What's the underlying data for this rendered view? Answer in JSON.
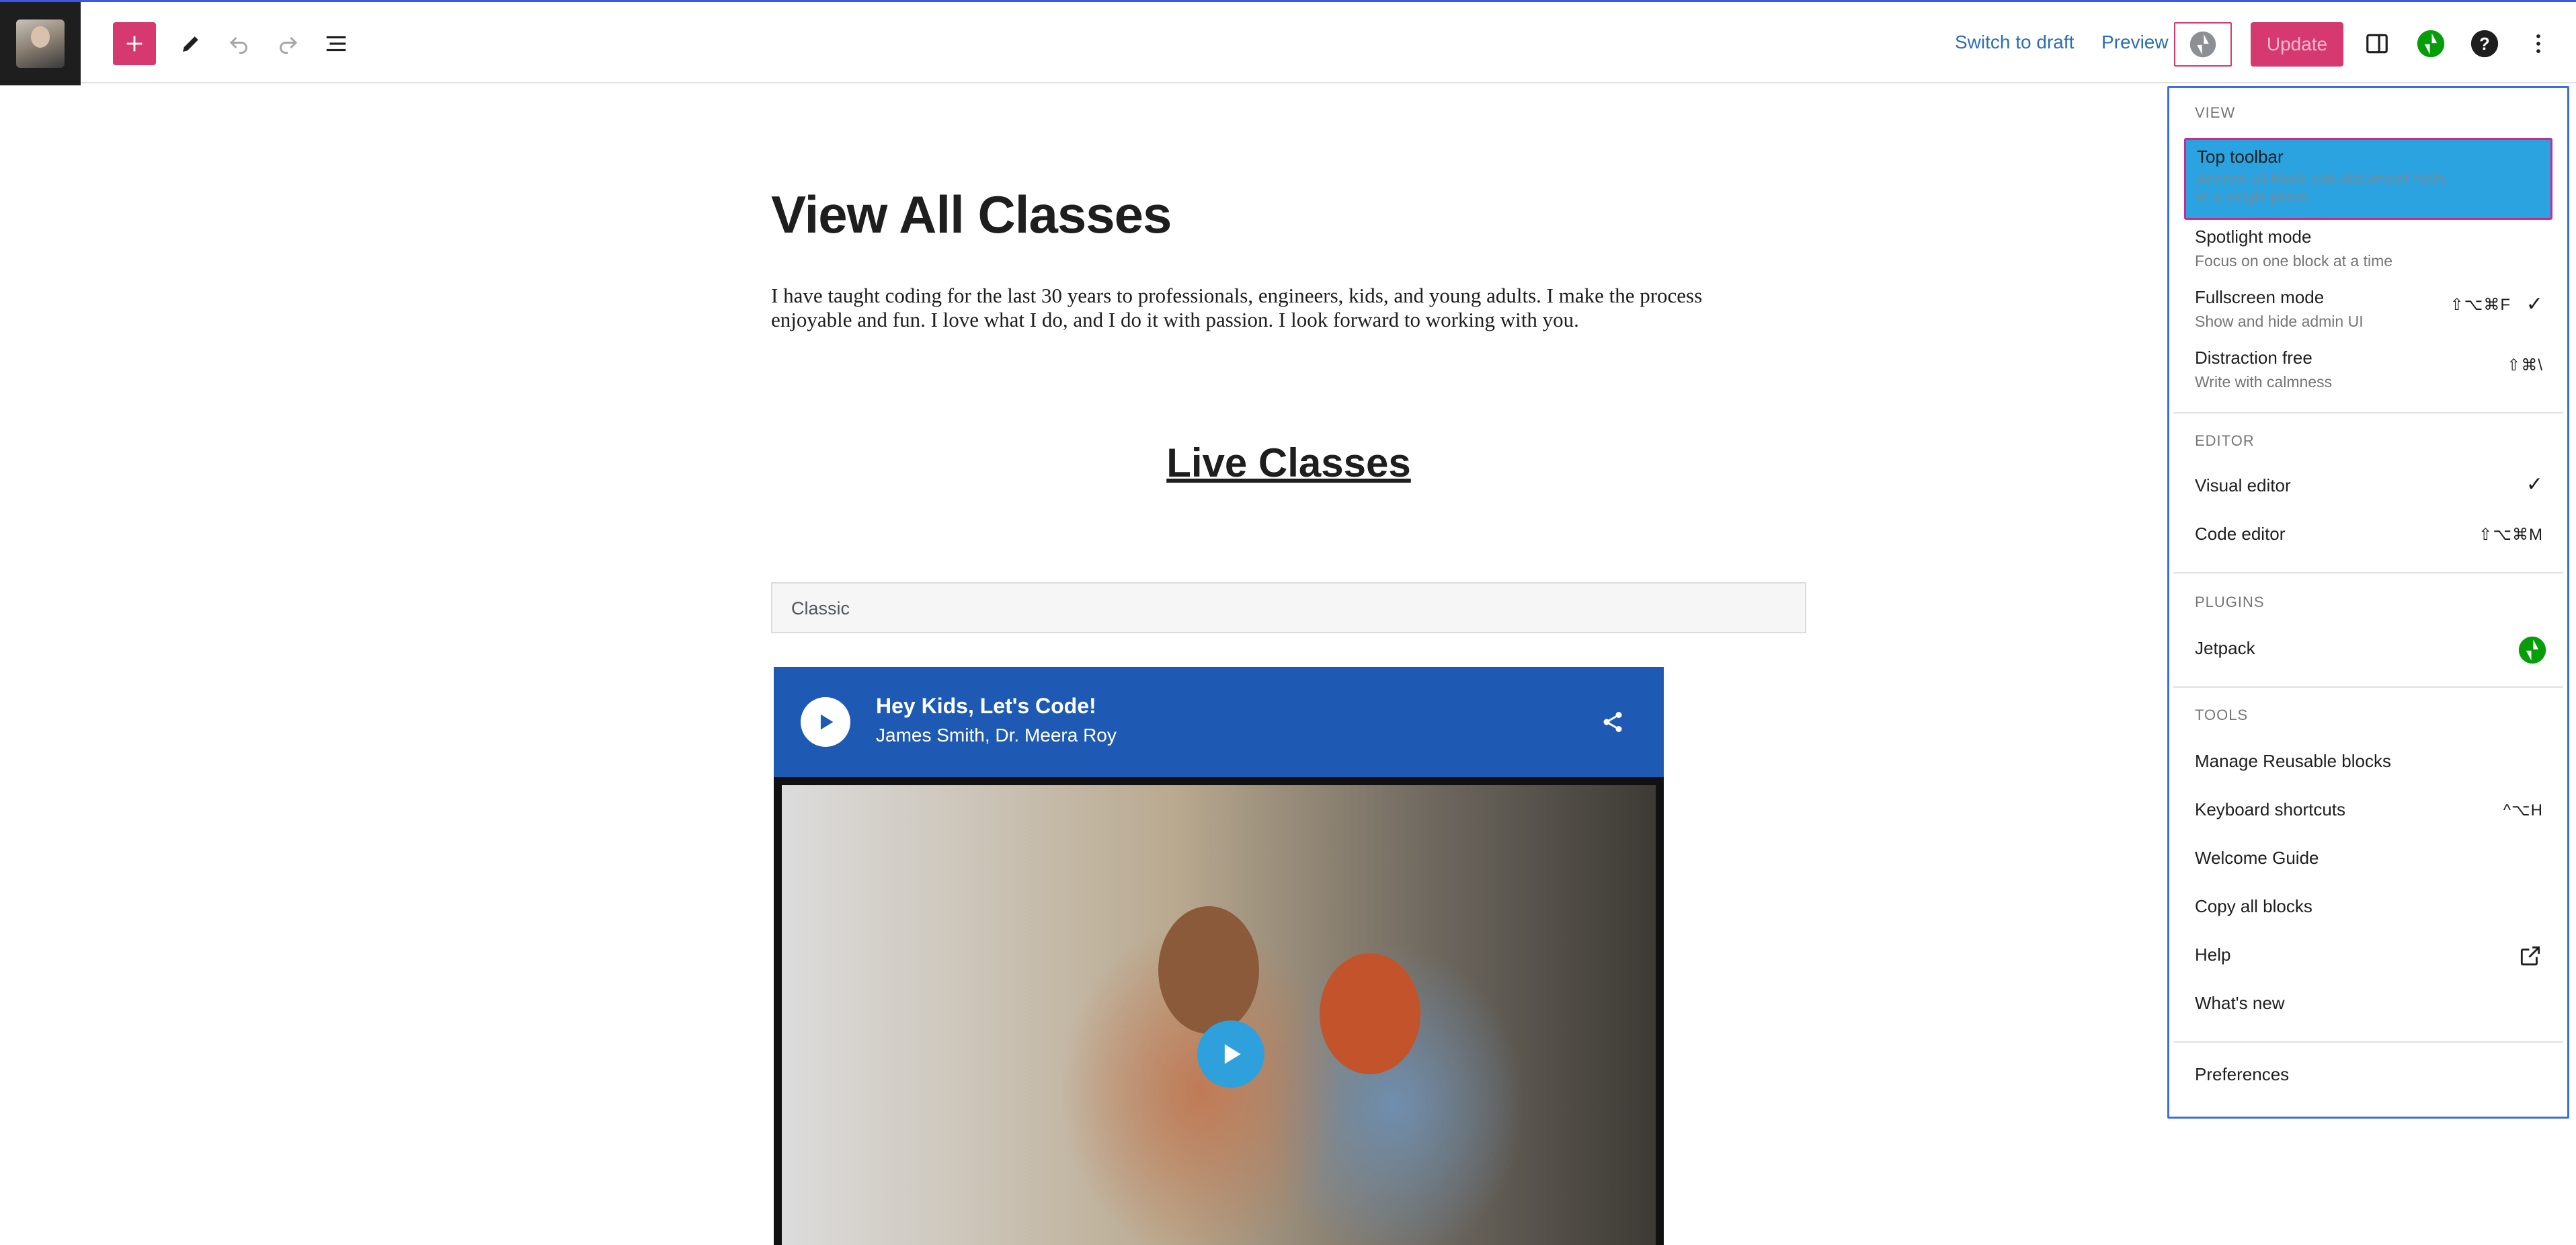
{
  "toolbar": {
    "switch_to_draft": "Switch to draft",
    "preview": "Preview",
    "update": "Update"
  },
  "content": {
    "title": "View All Classes",
    "intro": "I have taught coding for the last 30 years to professionals, engineers, kids, and young adults. I make the process enjoyable and fun. I love what I do, and I do it with passion. I look forward to working with you.",
    "section_heading": "Live Classes",
    "classic_label": "Classic",
    "player": {
      "title": "Hey Kids, Let's Code!",
      "subtitle": "James Smith, Dr. Meera Roy"
    }
  },
  "menu": {
    "view": {
      "label": "VIEW",
      "items": [
        {
          "label": "Top toolbar",
          "desc1": "Access all block and document tools",
          "desc2": "in a single place",
          "selected": true
        },
        {
          "label": "Spotlight mode",
          "desc1": "Focus on one block at a time"
        },
        {
          "label": "Fullscreen mode",
          "desc1": "Show and hide admin UI",
          "shortcut": "⇧⌥⌘F",
          "checked": true
        },
        {
          "label": "Distraction free",
          "desc1": "Write with calmness",
          "shortcut": "⇧⌘\\"
        }
      ]
    },
    "editor": {
      "label": "EDITOR",
      "items": [
        {
          "label": "Visual editor",
          "checked": true
        },
        {
          "label": "Code editor",
          "shortcut": "⇧⌥⌘M"
        }
      ]
    },
    "plugins": {
      "label": "PLUGINS",
      "items": [
        {
          "label": "Jetpack",
          "icon": "jetpack-icon"
        }
      ]
    },
    "tools": {
      "label": "TOOLS",
      "items": [
        {
          "label": "Manage Reusable blocks"
        },
        {
          "label": "Keyboard shortcuts",
          "shortcut": "^⌥H"
        },
        {
          "label": "Welcome Guide"
        },
        {
          "label": "Copy all blocks"
        },
        {
          "label": "Help",
          "icon": "external-link-icon"
        },
        {
          "label": "What's new"
        }
      ]
    },
    "preferences": {
      "label": "Preferences"
    }
  },
  "colors": {
    "accent": "#d63870",
    "focus_blue": "#3b6fe0",
    "selected_bg": "#2aa3e0",
    "jetpack_green": "#069e08",
    "link_blue": "#2b6fb0",
    "player_blue": "#1e5ab4"
  }
}
